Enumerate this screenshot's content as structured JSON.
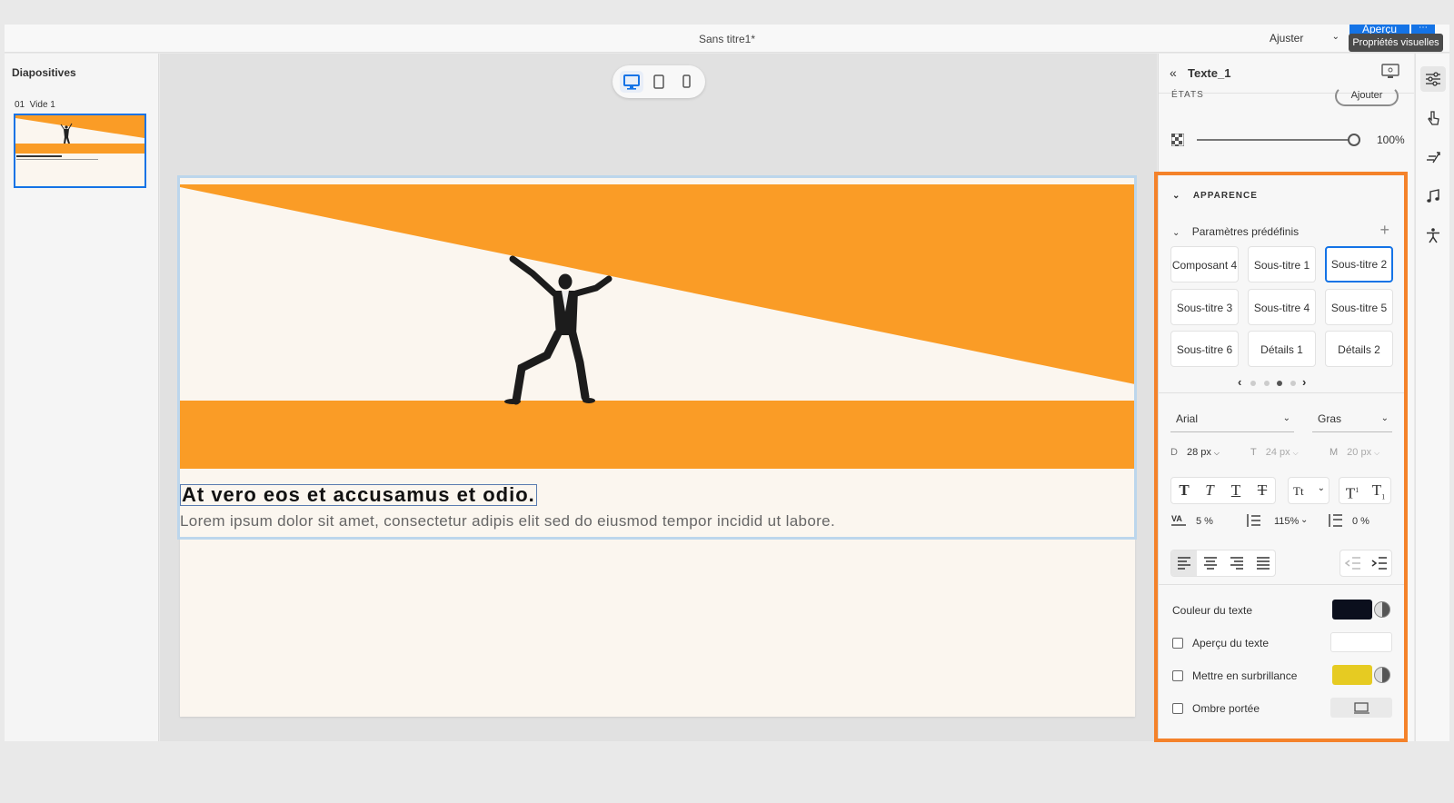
{
  "app": {
    "doc_title": "Sans titre1*",
    "zoom_label": "Ajuster",
    "preview_label": "Aperçu",
    "tooltip": "Propriétés visuelles"
  },
  "slides": {
    "title": "Diapositives",
    "items": [
      {
        "number": "01",
        "name": "Vide 1",
        "label": "01  Vide 1"
      }
    ]
  },
  "slide": {
    "heading": "At vero eos et accusamus et odio.",
    "body": "Lorem ipsum dolor sit amet, consectetur adipis elit sed do eiusmod tempor incidid ut labore.",
    "colors": {
      "orange": "#fa9c26",
      "cream": "#fbf6ef"
    }
  },
  "props": {
    "title": "Texte_1",
    "states_label": "ÉTATS",
    "add_state_label": "Ajouter",
    "opacity": "100%",
    "opacity_fraction": 1.0,
    "appearance_label": "APPARENCE",
    "presets_label": "Paramètres prédéfinis",
    "presets": [
      {
        "label": "Composant 4",
        "selected": false
      },
      {
        "label": "Sous-titre 1",
        "selected": false
      },
      {
        "label": "Sous-titre 2",
        "selected": true
      },
      {
        "label": "Sous-titre 3",
        "selected": false
      },
      {
        "label": "Sous-titre 4",
        "selected": false
      },
      {
        "label": "Sous-titre 5",
        "selected": false
      },
      {
        "label": "Sous-titre 6",
        "selected": false
      },
      {
        "label": "Détails 1",
        "selected": false
      },
      {
        "label": "Détails 2",
        "selected": false
      }
    ],
    "presets_page": 3,
    "presets_pages": 4,
    "font_family": "Arial",
    "font_weight": "Gras",
    "sizes": {
      "desktop_tag": "D",
      "desktop": "28 px",
      "tablet_tag": "T",
      "tablet": "24 px",
      "mobile_tag": "M",
      "mobile": "20 px"
    },
    "case_label": "Tt",
    "char_spacing": "5 %",
    "line_spacing": "115%",
    "para_spacing": "0 %",
    "text_color_label": "Couleur du texte",
    "text_color": "#0b0f1d",
    "text_preview_label": "Aperçu du texte",
    "highlight_label": "Mettre en surbrillance",
    "highlight_color": "#e6cb22",
    "shadow_label": "Ombre portée",
    "accent_color": "#f4822a",
    "selection_color": "#1473e6"
  }
}
